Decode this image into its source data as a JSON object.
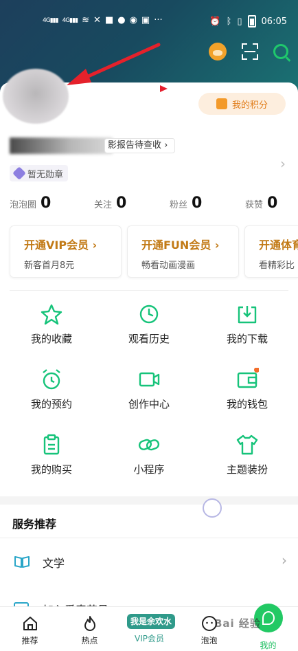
{
  "status_bar": {
    "left": "4G 4G",
    "time": "06:05"
  },
  "profile": {
    "report_text": "影报告待查收",
    "medal": "暂无勋章",
    "points_label": "我的积分"
  },
  "stats": [
    {
      "label": "泡泡圈",
      "value": "0"
    },
    {
      "label": "关注",
      "value": "0"
    },
    {
      "label": "粉丝",
      "value": "0"
    },
    {
      "label": "获赞",
      "value": "0"
    }
  ],
  "promos": [
    {
      "title": "开通VIP会员 ›",
      "sub": "新客首月8元"
    },
    {
      "title": "开通FUN会员 ›",
      "sub": "畅看动画漫画"
    },
    {
      "title": "开通体育",
      "sub": "看精彩比"
    }
  ],
  "grid": [
    {
      "label": "我的收藏",
      "icon": "star-icon"
    },
    {
      "label": "观看历史",
      "icon": "clock-icon"
    },
    {
      "label": "我的下载",
      "icon": "download-icon"
    },
    {
      "label": "我的预约",
      "icon": "alarm-icon"
    },
    {
      "label": "创作中心",
      "icon": "video-camera-icon"
    },
    {
      "label": "我的钱包",
      "icon": "wallet-icon"
    },
    {
      "label": "我的购买",
      "icon": "clipboard-icon"
    },
    {
      "label": "小程序",
      "icon": "link-icon"
    },
    {
      "label": "主题装扮",
      "icon": "shirt-icon"
    }
  ],
  "services": {
    "title": "服务推荐",
    "items": [
      {
        "label": "文学"
      },
      {
        "label": "加入爱奇艺号"
      }
    ]
  },
  "tabs": [
    {
      "label": "推荐"
    },
    {
      "label": "热点"
    },
    {
      "label": "VIP会员",
      "badge": "我是余欢水"
    },
    {
      "label": "泡泡"
    },
    {
      "label": "我的"
    }
  ],
  "watermark": "Bai 经验",
  "colors": {
    "accent": "#1fc86c",
    "vip_gold": "#c27a16",
    "points_orange": "#e07b18"
  }
}
